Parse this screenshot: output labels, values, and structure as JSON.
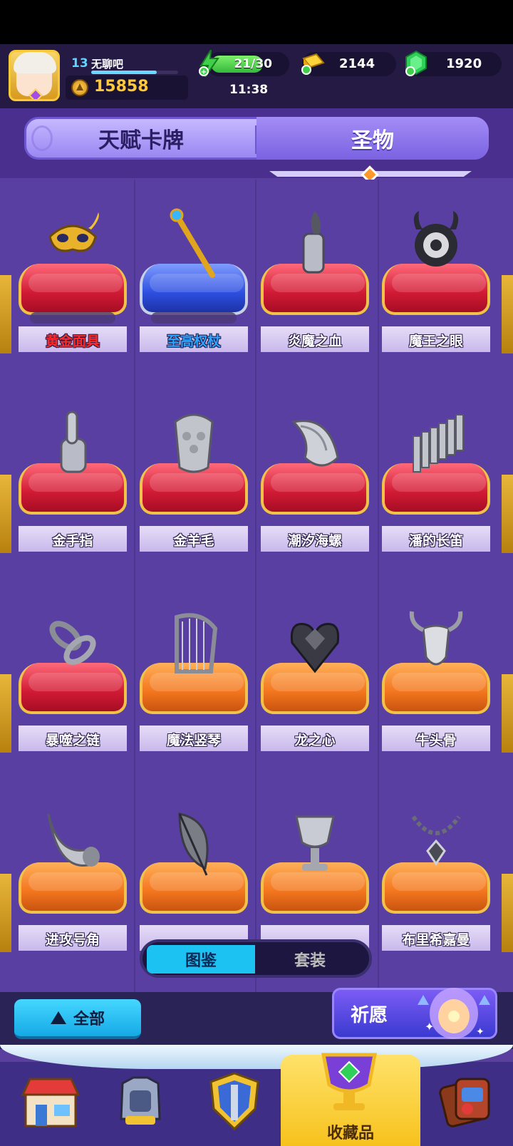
{
  "player": {
    "level": "13",
    "name": "无聊吧",
    "trophies": "15858",
    "xp_fraction": 0.75
  },
  "resources": {
    "energy": "21/30",
    "energy_fraction": 0.7,
    "timer": "11:38",
    "gold": "2144",
    "gems": "1920"
  },
  "tabs": [
    {
      "label": "天赋卡牌",
      "active": false
    },
    {
      "label": "圣物",
      "active": true
    }
  ],
  "relics": [
    {
      "name": "黄金面具",
      "cushion": "red",
      "name_color": "gold",
      "icon": "golden-mask-icon",
      "stars": true
    },
    {
      "name": "至高权杖",
      "cushion": "blue",
      "name_color": "blue",
      "icon": "scepter-icon",
      "stars": true
    },
    {
      "name": "炎魔之血",
      "cushion": "red",
      "icon": "blood-vial-icon"
    },
    {
      "name": "魔王之眼",
      "cushion": "red",
      "icon": "demon-eye-icon"
    },
    {
      "name": "金手指",
      "cushion": "red",
      "icon": "finger-icon"
    },
    {
      "name": "金羊毛",
      "cushion": "red",
      "icon": "fleece-icon"
    },
    {
      "name": "潮汐海螺",
      "cushion": "red",
      "icon": "conch-icon"
    },
    {
      "name": "潘的长笛",
      "cushion": "red",
      "icon": "pan-flute-icon"
    },
    {
      "name": "暴噬之链",
      "cushion": "red",
      "icon": "chain-icon"
    },
    {
      "name": "魔法竖琴",
      "cushion": "orange",
      "icon": "harp-icon"
    },
    {
      "name": "龙之心",
      "cushion": "orange",
      "icon": "dragon-heart-icon"
    },
    {
      "name": "牛头骨",
      "cushion": "orange",
      "icon": "bull-skull-icon"
    },
    {
      "name": "进攻号角",
      "cushion": "orange",
      "icon": "horn-icon"
    },
    {
      "name": "",
      "cushion": "orange",
      "icon": "feather-icon"
    },
    {
      "name": "",
      "cushion": "orange",
      "icon": "chalice-icon"
    },
    {
      "name": "布里希嘉曼",
      "cushion": "orange",
      "icon": "necklace-icon"
    }
  ],
  "view_toggle": {
    "on": "图鉴",
    "off": "套装"
  },
  "filter": {
    "label": "全部"
  },
  "wish": {
    "label": "祈愿"
  },
  "nav": {
    "active_label": "收藏品",
    "items": [
      "shop-icon",
      "armor-icon",
      "shield-icon",
      "collection-cup-icon",
      "cards-icon"
    ]
  },
  "colors": {
    "accent": "#1cc3f2",
    "bg": "#5a3fa3",
    "gold": "#ffc93a"
  }
}
